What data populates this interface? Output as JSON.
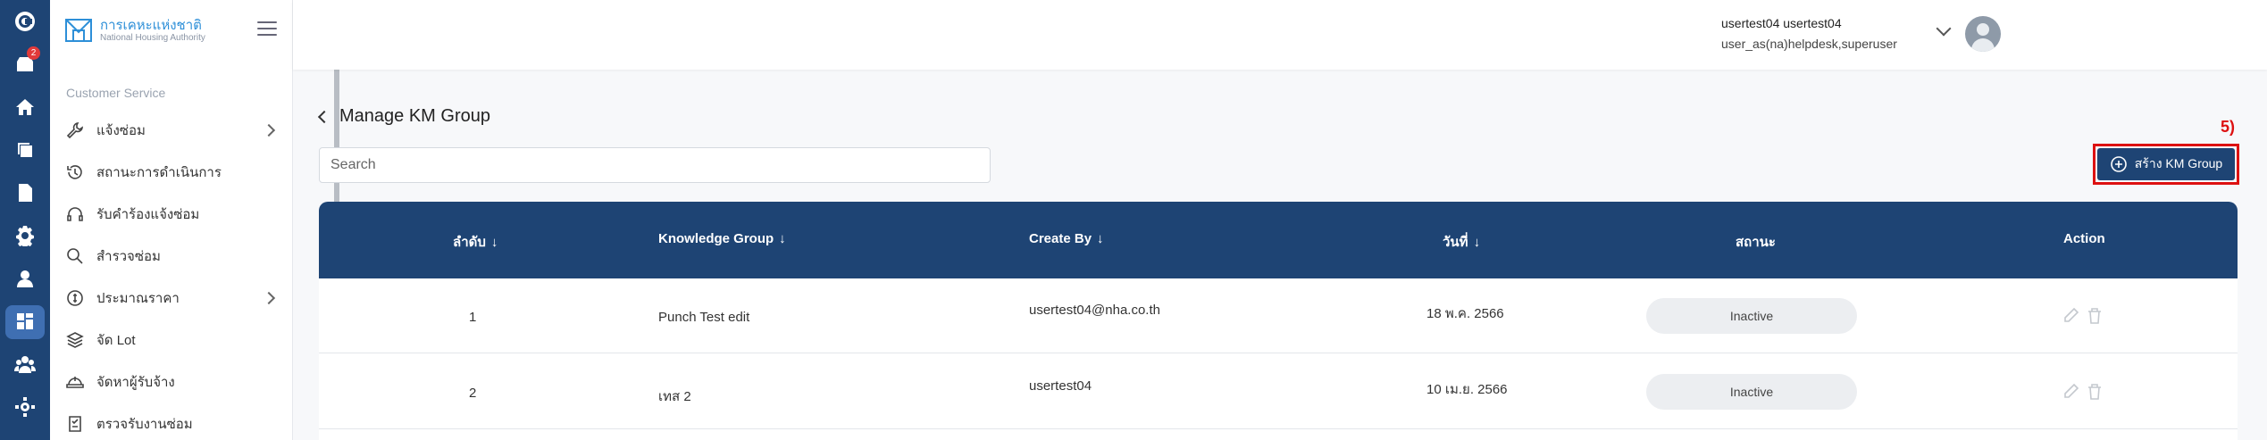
{
  "logo": {
    "thai_name": "การเคหะแห่งชาติ",
    "english_name": "National Housing Authority"
  },
  "rail": {
    "inbox_badge": "2"
  },
  "sidebar": {
    "section_title": "Customer Service",
    "items": [
      {
        "label": "แจ้งซ่อม",
        "icon": "wrench-icon",
        "has_submenu": true
      },
      {
        "label": "สถานะการดำเนินการ",
        "icon": "history-icon",
        "has_submenu": false
      },
      {
        "label": "รับคำร้องแจ้งซ่อม",
        "icon": "headset-icon",
        "has_submenu": false
      },
      {
        "label": "สำรวจซ่อม",
        "icon": "search-icon",
        "has_submenu": false
      },
      {
        "label": "ประมาณราคา",
        "icon": "coin-icon",
        "has_submenu": true
      },
      {
        "label": "จัด Lot",
        "icon": "layers-icon",
        "has_submenu": false
      },
      {
        "label": "จัดหาผู้รับจ้าง",
        "icon": "helmet-icon",
        "has_submenu": false
      },
      {
        "label": "ตรวจรับงานซ่อม",
        "icon": "checklist-icon",
        "has_submenu": false
      }
    ]
  },
  "user": {
    "name": "usertest04 usertest04",
    "role": "user_as(na)helpdesk,superuser"
  },
  "page": {
    "title": "Manage KM Group",
    "step_label": "5)"
  },
  "search": {
    "placeholder": "Search"
  },
  "create_button": {
    "label": "สร้าง KM Group"
  },
  "table": {
    "headers": {
      "index": "ลำดับ",
      "group": "Knowledge Group",
      "created_by": "Create By",
      "date": "วันที่",
      "status": "สถานะ",
      "action": "Action"
    },
    "rows": [
      {
        "index": "1",
        "group": "Punch Test edit",
        "created_by": "usertest04@nha.co.th",
        "date": "18 พ.ค. 2566",
        "status": "Inactive"
      },
      {
        "index": "2",
        "group": "เทส 2",
        "created_by": "usertest04",
        "date": "10 เม.ย. 2566",
        "status": "Inactive"
      }
    ]
  }
}
